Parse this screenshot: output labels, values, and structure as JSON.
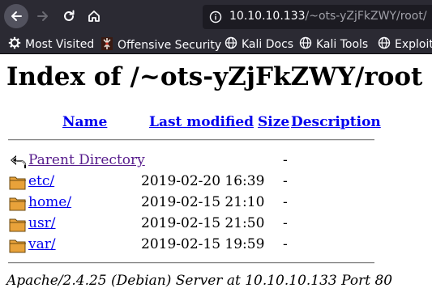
{
  "browser": {
    "url_host": "10.10.10.133",
    "url_path": "/~ots-yZjFkZWY/root/",
    "bookmarks": [
      {
        "label": "Most Visited",
        "icon": "gear-icon"
      },
      {
        "label": "Offensive Security",
        "icon": "offsec-icon"
      },
      {
        "label": "Kali Docs",
        "icon": "globe-icon"
      },
      {
        "label": "Kali Tools",
        "icon": "globe-icon"
      },
      {
        "label": "Exploit-",
        "icon": "globe-icon"
      }
    ]
  },
  "page": {
    "title": "Index of /~ots-yZjFkZWY/root",
    "columns": {
      "name": "Name",
      "modified": "Last modified",
      "size": "Size",
      "description": "Description"
    },
    "rows": [
      {
        "name": "Parent Directory",
        "modified": "",
        "size": "-",
        "icon": "back-icon",
        "visited": true
      },
      {
        "name": "etc/",
        "modified": "2019-02-20 16:39",
        "size": "-",
        "icon": "folder-icon"
      },
      {
        "name": "home/",
        "modified": "2019-02-15 21:10",
        "size": "-",
        "icon": "folder-icon"
      },
      {
        "name": "usr/",
        "modified": "2019-02-15 21:50",
        "size": "-",
        "icon": "folder-icon"
      },
      {
        "name": "var/",
        "modified": "2019-02-15 19:59",
        "size": "-",
        "icon": "folder-icon"
      }
    ],
    "footer": "Apache/2.4.25 (Debian) Server at 10.10.10.133 Port 80"
  }
}
